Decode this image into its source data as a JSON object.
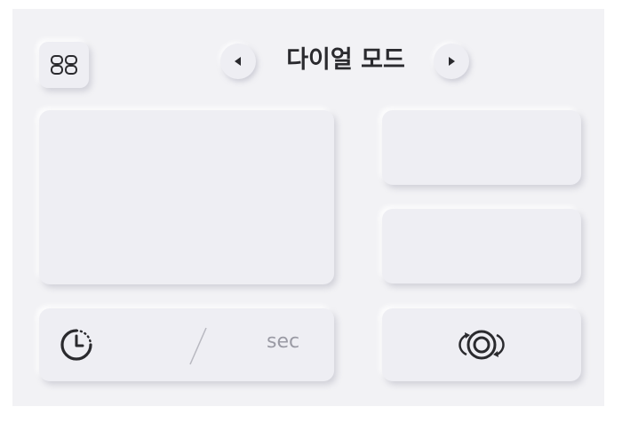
{
  "header": {
    "title": "다이얼 모드",
    "menu_icon": "grid-icon",
    "prev_icon": "triangle-left-icon",
    "next_icon": "triangle-right-icon"
  },
  "timer": {
    "icon": "timer-icon",
    "unit": "sec"
  },
  "action": {
    "icon": "rotate-camera-icon"
  },
  "colors": {
    "background": "#f2f2f5",
    "card": "#eeeef3",
    "text": "#2a2a2e",
    "muted": "#9a9aa4"
  }
}
